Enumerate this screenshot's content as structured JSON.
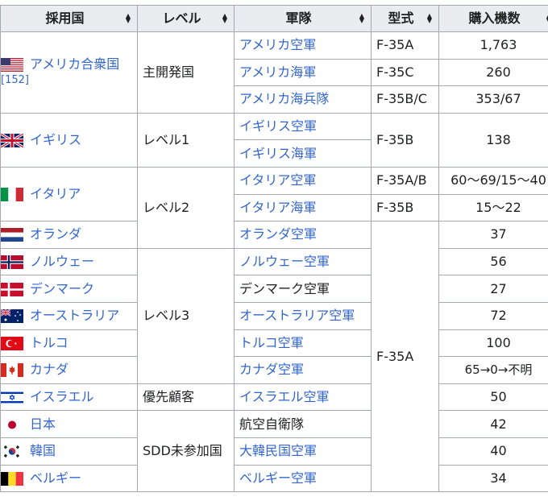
{
  "headers": [
    "採用国",
    "レベル",
    "軍隊",
    "型式",
    "購入機数"
  ],
  "countries": [
    {
      "name": "アメリカ合衆国",
      "cite": "[152]",
      "flag": "us"
    },
    {
      "name": "イギリス",
      "flag": "uk"
    },
    {
      "name": "イタリア",
      "flag": "it"
    },
    {
      "name": "オランダ",
      "flag": "nl"
    },
    {
      "name": "ノルウェー",
      "flag": "no"
    },
    {
      "name": "デンマーク",
      "flag": "dk"
    },
    {
      "name": "オーストラリア",
      "flag": "au"
    },
    {
      "name": "トルコ",
      "flag": "tr"
    },
    {
      "name": "カナダ",
      "flag": "ca"
    },
    {
      "name": "イスラエル",
      "flag": "il"
    },
    {
      "name": "日本",
      "flag": "jp"
    },
    {
      "name": "韓国",
      "flag": "kr"
    },
    {
      "name": "ベルギー",
      "flag": "be"
    }
  ],
  "levels": [
    "主開発国",
    "レベル1",
    "レベル2",
    "レベル3",
    "優先顧客",
    "SDD未参加国"
  ],
  "forces": [
    {
      "name": "アメリカ空軍",
      "link": true
    },
    {
      "name": "アメリカ海軍",
      "link": true
    },
    {
      "name": "アメリカ海兵隊",
      "link": true
    },
    {
      "name": "イギリス空軍",
      "link": true
    },
    {
      "name": "イギリス海軍",
      "link": true
    },
    {
      "name": "イタリア空軍",
      "link": true
    },
    {
      "name": "イタリア海軍",
      "link": true
    },
    {
      "name": "オランダ空軍",
      "link": true
    },
    {
      "name": "ノルウェー空軍",
      "link": true
    },
    {
      "name": "デンマーク空軍",
      "link": false
    },
    {
      "name": "オーストラリア空軍",
      "link": true
    },
    {
      "name": "トルコ空軍",
      "link": true
    },
    {
      "name": "カナダ空軍",
      "link": true
    },
    {
      "name": "イスラエル空軍",
      "link": true
    },
    {
      "name": "航空自衛隊",
      "link": false
    },
    {
      "name": "大韓民国空軍",
      "link": true
    },
    {
      "name": "ベルギー空軍",
      "link": true
    }
  ],
  "models": [
    "F-35A",
    "F-35C",
    "F-35B/C",
    "F-35B",
    "F-35A/B",
    "F-35B",
    "F-35A"
  ],
  "quantities": [
    "1,763",
    "260",
    "353/67",
    "138",
    "60〜69/15〜40",
    "15〜22",
    "37",
    "56",
    "27",
    "72",
    "100",
    "65→0→不明",
    "50",
    "42",
    "40",
    "34"
  ],
  "colors": {
    "link": "#3366cc",
    "header_bg": "#eaecf0",
    "border": "#a2a9b1",
    "text": "#202122"
  }
}
